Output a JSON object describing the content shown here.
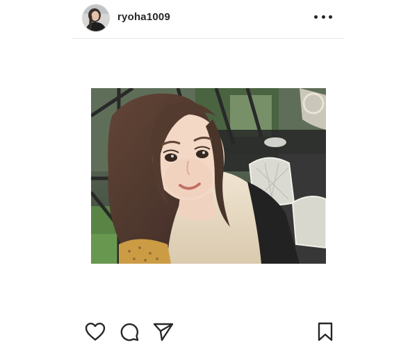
{
  "post": {
    "username": "ryoha1009",
    "more_icon": "more-horizontal-icon"
  },
  "actions": {
    "like_icon": "heart-icon",
    "comment_icon": "comment-icon",
    "share_icon": "send-icon",
    "save_icon": "bookmark-icon"
  },
  "colors": {
    "text": "#262626",
    "divider": "#e6e6e6",
    "background": "#ffffff"
  }
}
